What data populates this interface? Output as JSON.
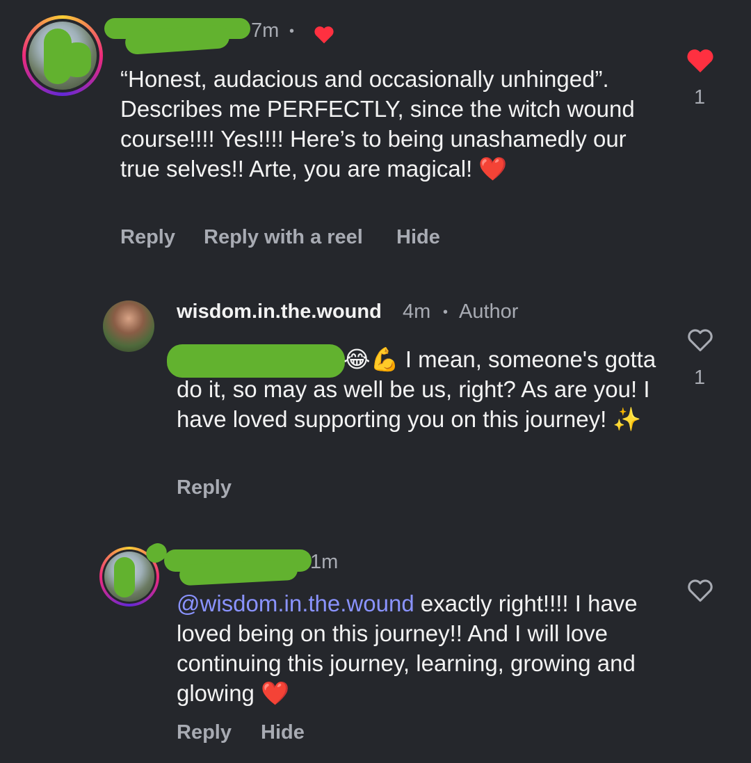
{
  "comments": [
    {
      "time": "7m",
      "text": "“Honest, audacious and occasionally unhinged”. Describes me PERFECTLY, since the witch wound course!!!! Yes!!!! Here’s to being unashamedly our true selves!! Arte, you are magical!",
      "emoji_end": "❤️",
      "like_count": "1",
      "liked": true,
      "actions": [
        "Reply",
        "Reply with a reel",
        "Hide"
      ],
      "icons": [
        "heart-filled-icon",
        "avatar-mini-icon"
      ]
    },
    {
      "username": "wisdom.in.the.wound",
      "time": "4m",
      "author_badge": "Author",
      "emoji_start": "😂💪",
      "text": "I mean, someone's gotta do it, so may as well be us, right? As are you! I have loved supporting you on this journey!",
      "emoji_end": "✨",
      "like_count": "1",
      "liked": false,
      "actions": [
        "Reply"
      ]
    },
    {
      "time": "1m",
      "mention": "@wisdom.in.the.wound",
      "text": "exactly right!!!! I have loved being on this journey!! And I will love continuing this journey, learning, growing and glowing",
      "emoji_end": "❤️",
      "liked": false,
      "actions": [
        "Reply",
        "Hide"
      ]
    }
  ],
  "colors": {
    "background": "#25272c",
    "text": "#f3f3f3",
    "muted": "#a8abb3",
    "mention": "#8a93ff",
    "like_red": "#ff3040",
    "redaction_green": "#62b22f"
  }
}
